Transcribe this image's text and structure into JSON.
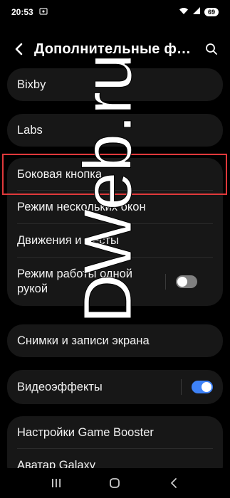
{
  "status_bar": {
    "time": "20:53",
    "left_icon": "screenshot-icon",
    "icons": [
      "wifi-icon",
      "signal-icon"
    ],
    "battery": "69"
  },
  "header": {
    "title": "Дополнительные ф…",
    "back_icon": "chevron-left-icon",
    "search_icon": "search-icon"
  },
  "settings": {
    "bixby": {
      "label": "Bixby"
    },
    "labs": {
      "label": "Labs"
    },
    "group3": [
      {
        "label": "Боковая кнопка"
      },
      {
        "label": "Режим нескольких окон"
      },
      {
        "label": "Движения и жесты"
      },
      {
        "label": "Режим работы одной рукой",
        "toggle": false
      }
    ],
    "screenshots": {
      "label": "Снимки и записи экрана"
    },
    "video_effects": {
      "label": "Видеоэффекты",
      "toggle": true
    },
    "group6": [
      {
        "label": "Настройки Game Booster"
      },
      {
        "label": "Аватар Galaxy"
      }
    ]
  },
  "watermark": {
    "text": "DWeb.ru"
  },
  "highlight_color": "#e0393b",
  "accent_color": "#3e82f7",
  "nav": {
    "recents_icon": "recents-icon",
    "home_icon": "home-icon",
    "back_icon": "back-icon"
  }
}
